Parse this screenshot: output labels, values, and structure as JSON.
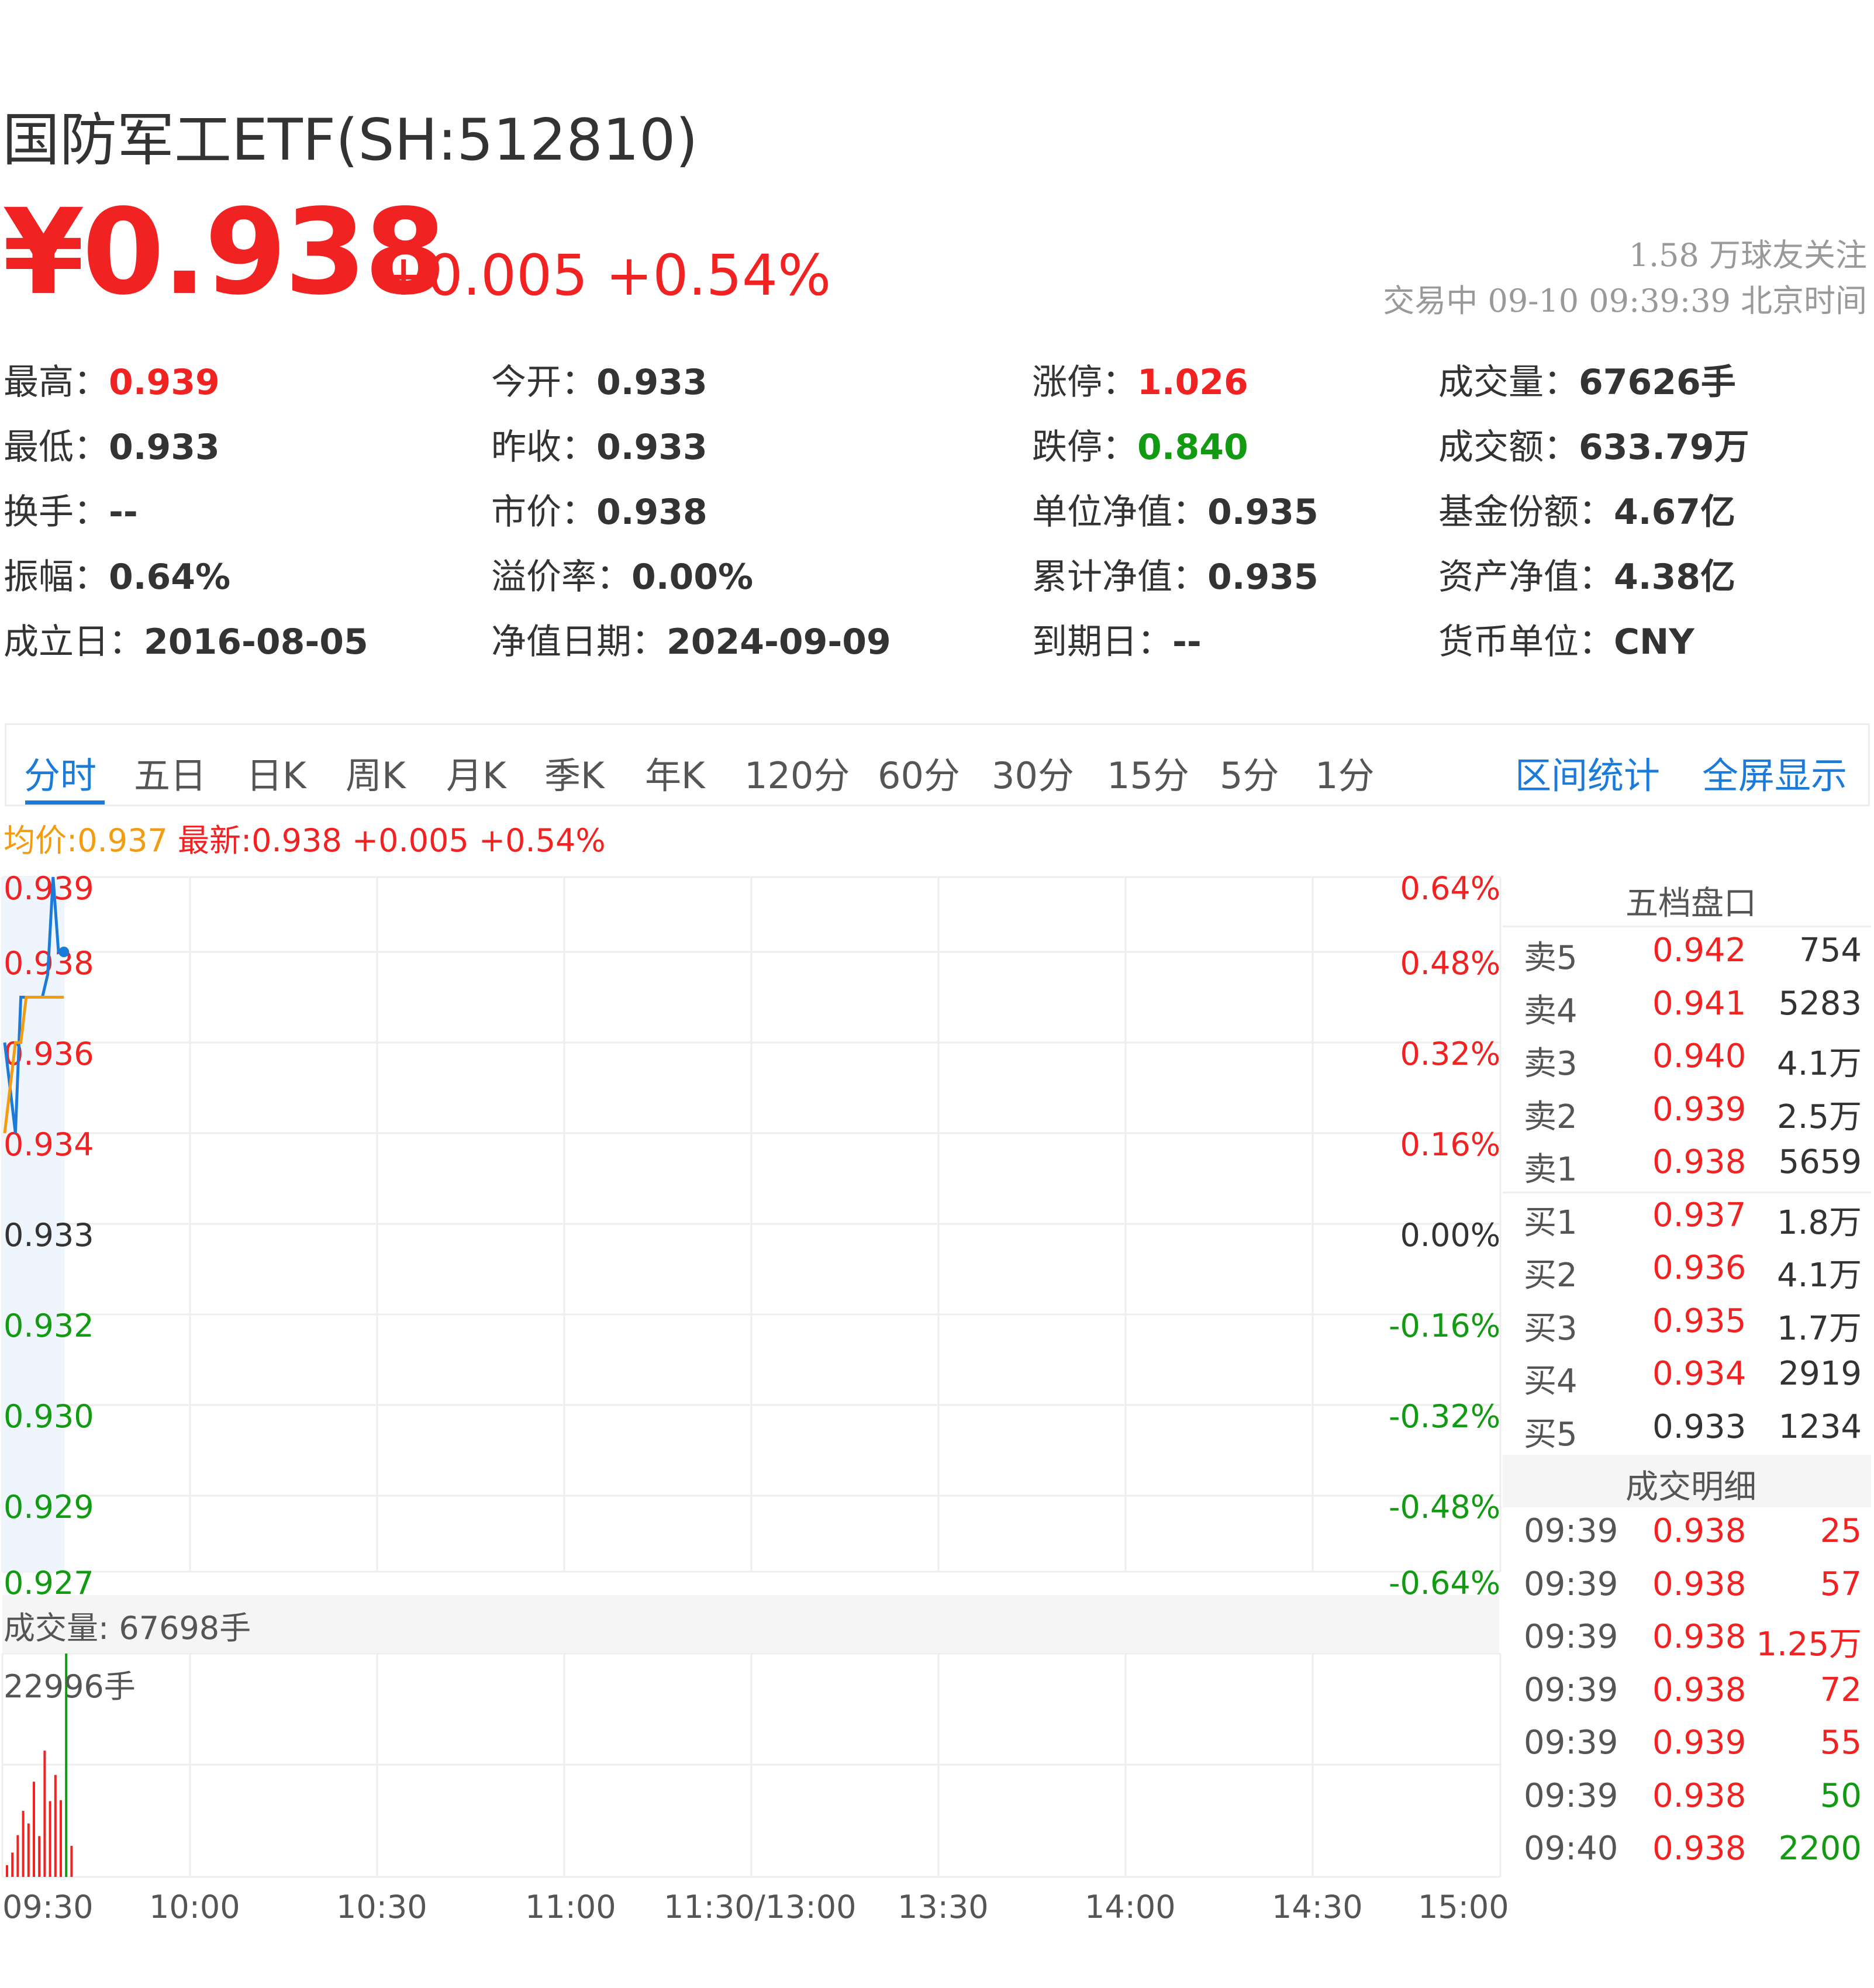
{
  "header": {
    "title": "国防军工ETF(SH:512810)",
    "price": "¥0.938",
    "change": "+0.005 +0.54%",
    "followers": "1.58 万球友关注",
    "status": "交易中 09-10 09:39:39 北京时间"
  },
  "stats": [
    [
      {
        "label": "最高：",
        "value": "0.939",
        "color": "red"
      },
      {
        "label": "今开：",
        "value": "0.933",
        "color": ""
      },
      {
        "label": "涨停：",
        "value": "1.026",
        "color": "red"
      },
      {
        "label": "成交量：",
        "value": "67626手",
        "color": ""
      }
    ],
    [
      {
        "label": "最低：",
        "value": "0.933",
        "color": ""
      },
      {
        "label": "昨收：",
        "value": "0.933",
        "color": ""
      },
      {
        "label": "跌停：",
        "value": "0.840",
        "color": "green"
      },
      {
        "label": "成交额：",
        "value": "633.79万",
        "color": ""
      }
    ],
    [
      {
        "label": "换手：",
        "value": "--",
        "color": ""
      },
      {
        "label": "市价：",
        "value": "0.938",
        "color": ""
      },
      {
        "label": "单位净值：",
        "value": "0.935",
        "color": ""
      },
      {
        "label": "基金份额：",
        "value": "4.67亿",
        "color": ""
      }
    ],
    [
      {
        "label": "振幅：",
        "value": "0.64%",
        "color": ""
      },
      {
        "label": "溢价率：",
        "value": "0.00%",
        "color": ""
      },
      {
        "label": "累计净值：",
        "value": "0.935",
        "color": ""
      },
      {
        "label": "资产净值：",
        "value": "4.38亿",
        "color": ""
      }
    ],
    [
      {
        "label": "成立日：",
        "value": "2016-08-05",
        "color": ""
      },
      {
        "label": "净值日期：",
        "value": "2024-09-09",
        "color": ""
      },
      {
        "label": "到期日：",
        "value": "--",
        "color": ""
      },
      {
        "label": "货币单位：",
        "value": "CNY",
        "color": ""
      }
    ]
  ],
  "tabs": [
    "分时",
    "五日",
    "日K",
    "周K",
    "月K",
    "季K",
    "年K",
    "120分",
    "60分",
    "30分",
    "15分",
    "5分",
    "1分"
  ],
  "tab_links": [
    "区间统计",
    "全屏显示"
  ],
  "legend": {
    "avg": "均价:0.937",
    "new": "最新:0.938 +0.005 +0.54%"
  },
  "chart_data": {
    "type": "line",
    "title": "",
    "y_left_ticks": [
      "0.939",
      "0.938",
      "0.936",
      "0.934",
      "0.933",
      "0.932",
      "0.930",
      "0.929",
      "0.927"
    ],
    "y_right_ticks": [
      "0.64%",
      "0.48%",
      "0.32%",
      "0.16%",
      "0.00%",
      "-0.16%",
      "-0.32%",
      "-0.48%",
      "-0.64%"
    ],
    "ylim": [
      0.927,
      0.939
    ],
    "x_ticks": [
      "09:30",
      "10:00",
      "10:30",
      "11:00",
      "11:30/13:00",
      "13:30",
      "14:00",
      "14:30",
      "15:00"
    ],
    "series": [
      {
        "name": "最新",
        "color": "#1c7bd8",
        "values": [
          0.936,
          0.935,
          0.934,
          0.937,
          0.937,
          0.937,
          0.937,
          0.937,
          0.9375,
          0.939,
          0.938,
          0.938
        ]
      },
      {
        "name": "均价",
        "color": "#f39c12",
        "values": [
          0.934,
          0.935,
          0.936,
          0.936,
          0.937,
          0.937,
          0.937,
          0.937,
          0.937,
          0.937,
          0.937,
          0.937
        ]
      }
    ],
    "volume": {
      "label": "成交量: 67698手",
      "max_label": "22996手",
      "values": [
        1200,
        2500,
        4300,
        6800,
        5500,
        9800,
        4200,
        13000,
        7800,
        10500,
        7900,
        22996,
        3200
      ],
      "colors": [
        "red",
        "red",
        "red",
        "red",
        "red",
        "red",
        "red",
        "red",
        "red",
        "red",
        "red",
        "green",
        "red"
      ]
    }
  },
  "order_book": {
    "title": "五档盘口",
    "asks": [
      {
        "label": "卖5",
        "price": "0.942",
        "vol": "754"
      },
      {
        "label": "卖4",
        "price": "0.941",
        "vol": "5283"
      },
      {
        "label": "卖3",
        "price": "0.940",
        "vol": "4.1万"
      },
      {
        "label": "卖2",
        "price": "0.939",
        "vol": "2.5万"
      },
      {
        "label": "卖1",
        "price": "0.938",
        "vol": "5659"
      }
    ],
    "bids": [
      {
        "label": "买1",
        "price": "0.937",
        "vol": "1.8万",
        "pcolor": "red"
      },
      {
        "label": "买2",
        "price": "0.936",
        "vol": "4.1万",
        "pcolor": "red"
      },
      {
        "label": "买3",
        "price": "0.935",
        "vol": "1.7万",
        "pcolor": "red"
      },
      {
        "label": "买4",
        "price": "0.934",
        "vol": "2919",
        "pcolor": "red"
      },
      {
        "label": "买5",
        "price": "0.933",
        "vol": "1234",
        "pcolor": "black"
      }
    ]
  },
  "trades": {
    "title": "成交明细",
    "rows": [
      {
        "time": "09:39",
        "price": "0.938",
        "vol": "25",
        "vcolor": "red"
      },
      {
        "time": "09:39",
        "price": "0.938",
        "vol": "57",
        "vcolor": "red"
      },
      {
        "time": "09:39",
        "price": "0.938",
        "vol": "1.25万",
        "vcolor": "red"
      },
      {
        "time": "09:39",
        "price": "0.938",
        "vol": "72",
        "vcolor": "red"
      },
      {
        "time": "09:39",
        "price": "0.939",
        "vol": "55",
        "vcolor": "red"
      },
      {
        "time": "09:39",
        "price": "0.938",
        "vol": "50",
        "vcolor": "green"
      },
      {
        "time": "09:40",
        "price": "0.938",
        "vol": "2200",
        "vcolor": "green"
      }
    ]
  }
}
